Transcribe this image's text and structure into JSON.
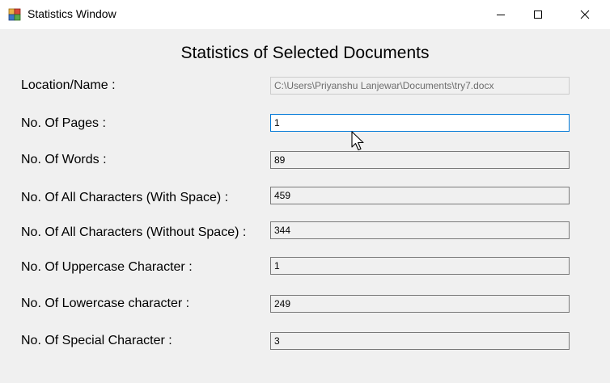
{
  "window": {
    "title": "Statistics Window",
    "icon": "app-icon",
    "controls": [
      "minimize-icon",
      "maximize-icon",
      "close-icon"
    ]
  },
  "heading": "Statistics of Selected Documents",
  "fields": [
    {
      "label": "Location/Name :",
      "value": "C:\\Users\\Priyanshu Lanjewar\\Documents\\try7.docx"
    },
    {
      "label": "No. Of Pages :",
      "value": "1"
    },
    {
      "label": "No. Of Words :",
      "value": "89"
    },
    {
      "label": "No. Of All Characters (With Space) :",
      "value": "459"
    },
    {
      "label": "No. Of All Characters (Without Space) :",
      "value": "344"
    },
    {
      "label": "No. Of Uppercase Character :",
      "value": "1"
    },
    {
      "label": "No. Of Lowercase character :",
      "value": "249"
    },
    {
      "label": "No. Of Special Character :",
      "value": "3"
    }
  ]
}
